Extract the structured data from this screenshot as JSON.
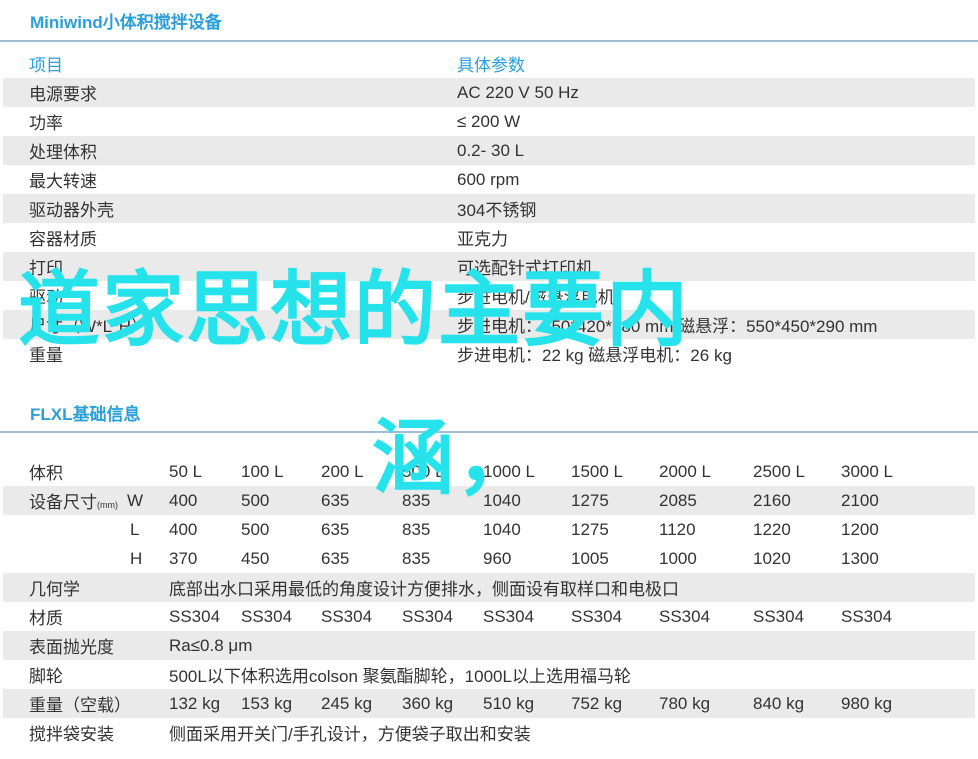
{
  "section1": {
    "title": "Miniwind小体积搅拌设备",
    "header": {
      "item": "项目",
      "param": "具体参数"
    },
    "rows": [
      {
        "item": "电源要求",
        "value": "AC 220  V 50 Hz"
      },
      {
        "item": "功率",
        "value": "≤ 200 W"
      },
      {
        "item": "处理体积",
        "value": "0.2-  30 L"
      },
      {
        "item": "最大转速",
        "value": "600  rpm"
      },
      {
        "item": "驱动器外壳",
        "value": "304不锈钢"
      },
      {
        "item": "容器材质",
        "value": "亚克力"
      },
      {
        "item": "打印",
        "value": "可选配针式打印机"
      },
      {
        "item": "驱动",
        "value": "步进电机/磁悬浮电机"
      },
      {
        "item": "尺寸（W*L*H）",
        "value": "步进电机：450*420*280 mm/磁悬浮：550*450*290 mm"
      },
      {
        "item": "重量",
        "value": "步进电机：22 kg 磁悬浮电机：26 kg"
      }
    ]
  },
  "section2": {
    "title": "FLXL基础信息",
    "volume": {
      "label": "体积",
      "values": [
        "50 L",
        "100 L",
        "200 L",
        "500 L",
        "1000 L",
        "1500 L",
        "2000 L",
        "2500 L",
        "3000 L"
      ]
    },
    "dims": {
      "label": "设备尺寸",
      "unit": "(mm)",
      "rows": [
        {
          "axis": "W",
          "values": [
            "400",
            "500",
            "635",
            "835",
            "1040",
            "1275",
            "2085",
            "2160",
            "2100"
          ]
        },
        {
          "axis": "L",
          "values": [
            "400",
            "500",
            "635",
            "835",
            "1040",
            "1275",
            "1120",
            "1220",
            "1200"
          ]
        },
        {
          "axis": "H",
          "values": [
            "370",
            "450",
            "635",
            "835",
            "960",
            "1005",
            "1000",
            "1020",
            "1300"
          ]
        }
      ]
    },
    "geometry": {
      "label": "几何学",
      "value": "底部出水口采用最低的角度设计方便排水，侧面设有取样口和电极口"
    },
    "material": {
      "label": "材质",
      "values": [
        "SS304",
        "SS304",
        "SS304",
        "SS304",
        "SS304",
        "SS304",
        "SS304",
        "SS304",
        "SS304"
      ]
    },
    "finish": {
      "label": "表面抛光度",
      "value": "Ra≤0.8 μm"
    },
    "wheels": {
      "label": "脚轮",
      "value": "500L以下体积选用colson 聚氨酯脚轮，1000L以上选用福马轮"
    },
    "weight": {
      "label": "重量（空载）",
      "values": [
        "132 kg",
        "153 kg",
        "245 kg",
        "360 kg",
        "510 kg",
        "752 kg",
        "780 kg",
        "840 kg",
        "980 kg"
      ]
    },
    "bag": {
      "label": "搅拌袋安装",
      "value": "侧面采用开关门/手孔设计，方便袋子取出和安装"
    }
  },
  "overlay": {
    "line1": "道家思想的主要内",
    "line2": "涵，"
  }
}
